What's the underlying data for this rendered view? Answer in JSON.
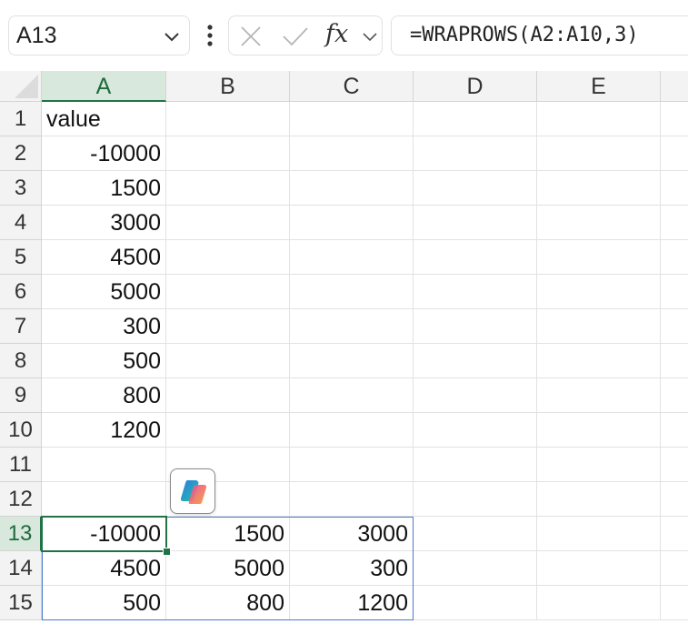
{
  "formula_bar": {
    "name_box": "A13",
    "formula": "=WRAPROWS(A2:A10,3)",
    "fx_label": "fx"
  },
  "columns": [
    "A",
    "B",
    "C",
    "D",
    "E"
  ],
  "rows": [
    "1",
    "2",
    "3",
    "4",
    "5",
    "6",
    "7",
    "8",
    "9",
    "10",
    "11",
    "12",
    "13",
    "14",
    "15"
  ],
  "cells": {
    "A1": "value",
    "A2": "-10000",
    "A3": "1500",
    "A4": "3000",
    "A5": "4500",
    "A6": "5000",
    "A7": "300",
    "A8": "500",
    "A9": "800",
    "A10": "1200",
    "A13": "-10000",
    "B13": "1500",
    "C13": "3000",
    "A14": "4500",
    "B14": "5000",
    "C14": "300",
    "A15": "500",
    "B15": "800",
    "C15": "1200"
  },
  "selection": {
    "active_cell": "A13",
    "active_column": "A",
    "active_row": "13"
  },
  "colors": {
    "accent_green": "#217346",
    "spill_border": "#4a7bd0",
    "header_bg": "#f3f3f3",
    "selected_header_bg": "#d8e8dc"
  },
  "icons": {
    "name_box_dropdown": "chevron-down-icon",
    "more": "vertical-ellipsis-icon",
    "cancel": "close-icon",
    "confirm": "check-icon",
    "function": "fx-icon",
    "fx_dropdown": "chevron-down-icon",
    "copilot": "copilot-icon"
  }
}
